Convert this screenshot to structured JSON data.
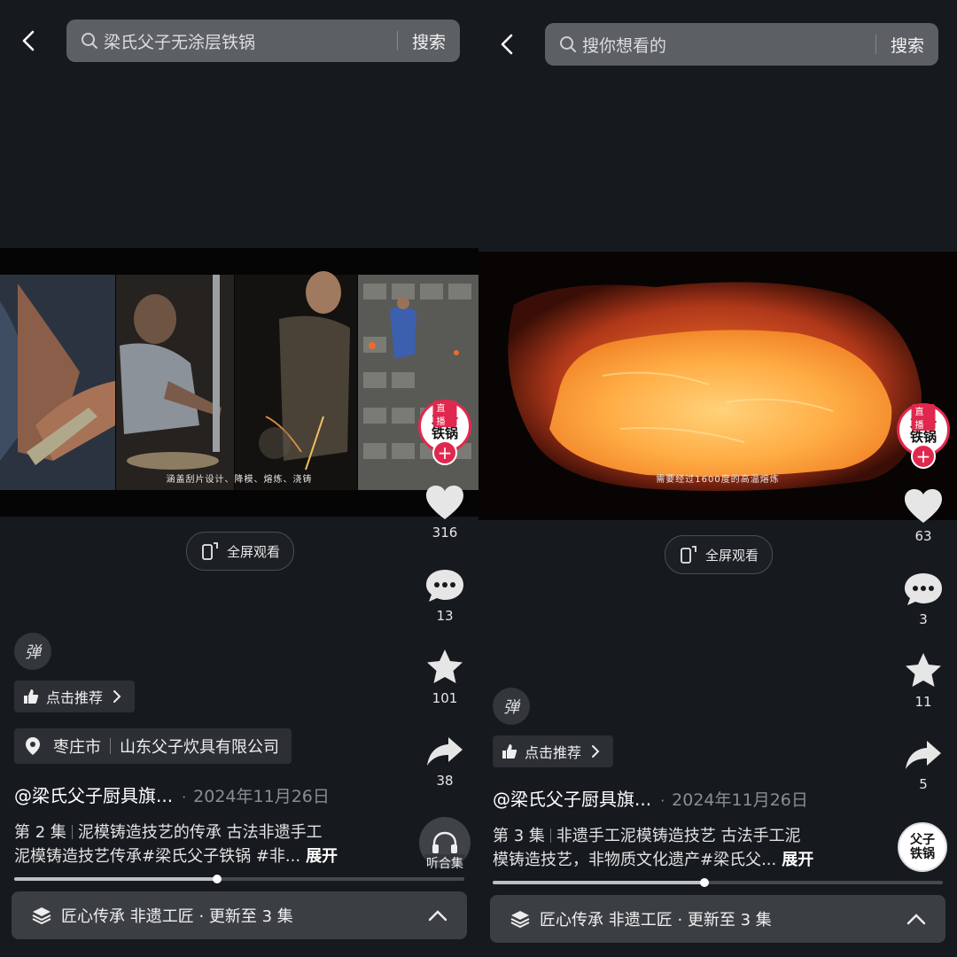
{
  "panels": [
    {
      "search_text": "梁氏父子无涂层铁锅",
      "search_button": "搜索",
      "video_subtitle": "涵盖刮片设计、降模、熔炼、浇铸",
      "fullscreen_label": "全屏观看",
      "live_tag": "直播",
      "live_logo": "父子铁锅",
      "likes": "316",
      "comments": "13",
      "favorites": "101",
      "shares": "38",
      "danmu_label": "弹",
      "recommend_label": "点击推荐",
      "location_city": "枣庄市",
      "location_company": "山东父子炊具有限公司",
      "author": "@梁氏父子厨具旗...",
      "date": "2024年11月26日",
      "episode": "第 2 集",
      "desc_line1": "泥模铸造技艺的传承 古法非遗手工",
      "desc_line2": "泥模铸造技艺传承#梁氏父子铁锅 #非...",
      "expand_label": "展开",
      "listen_label": "听合集",
      "progress": 0.45,
      "collection_label": "匠心传承 非遗工匠 · 更新至 3 集"
    },
    {
      "search_text": "搜你想看的",
      "search_button": "搜索",
      "video_subtitle": "需要经过1600度的高温熔炼",
      "fullscreen_label": "全屏观看",
      "live_tag": "直播",
      "live_logo": "父子铁锅",
      "likes": "63",
      "comments": "3",
      "favorites": "11",
      "shares": "5",
      "danmu_label": "弹",
      "recommend_label": "点击推荐",
      "author": "@梁氏父子厨具旗...",
      "date": "2024年11月26日",
      "episode": "第 3 集",
      "desc_line1": "非遗手工泥模铸造技艺 古法手工泥",
      "desc_line2": "模铸造技艺，非物质文化遗产#梁氏父...",
      "expand_label": "展开",
      "music_logo": "父子铁锅",
      "progress": 0.47,
      "collection_label": "匠心传承 非遗工匠 · 更新至 3 集"
    }
  ],
  "colors": {
    "background": "#161a1e",
    "search_bg": "#5c5f63",
    "live_red": "#e0284e",
    "chip_bg": "#2c3034"
  }
}
